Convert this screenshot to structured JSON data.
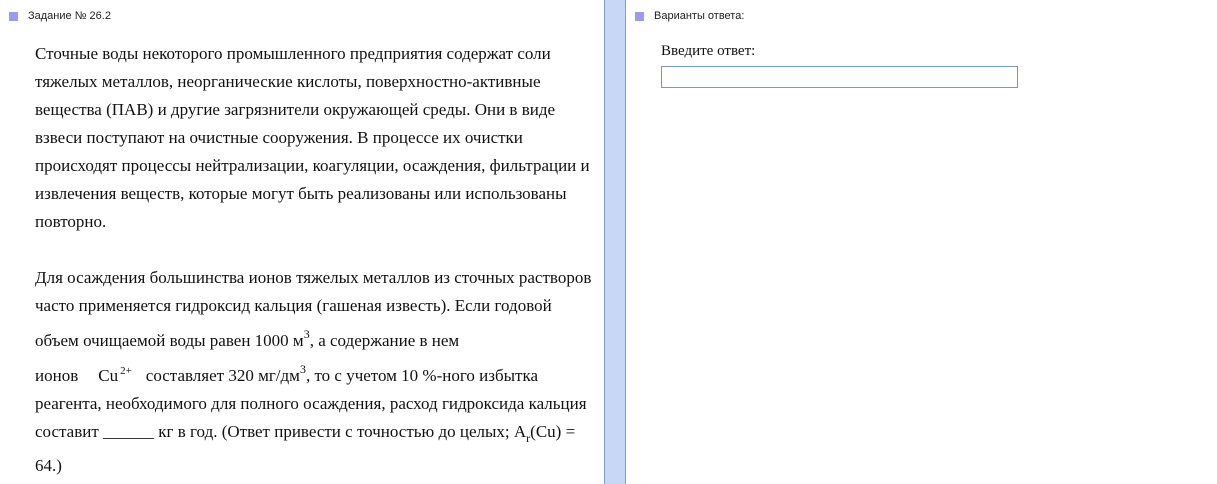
{
  "left_panel": {
    "header": "Задание № 26.2",
    "paragraph1": "Сточные воды некоторого промышленного предприятия содержат соли тяжелых металлов, неорганические кислоты, поверхностно-активные вещества (ПАВ) и другие загрязнители окружающей среды. Они в виде взвеси поступают на очистные сооружения. В процессе их очистки происходят процессы нейтрализации, коагуляции, осаждения, фильтрации и извлечения веществ, которые могут быть реализованы или использованы повторно.",
    "paragraph2": {
      "part1": "Для осаждения большинства ионов тяжелых металлов из сточных растворов часто применяется гидроксид кальция (гашеная известь). Если годовой объем очищаемой воды равен 1000 м",
      "exp1": "3",
      "part2": ", а содержание в нем ионов",
      "ion": "Cu",
      "ion_charge": "2+",
      "part3": "составляет 320 мг/дм",
      "exp2": "3",
      "part4": ", то с учетом 10 %-ного избытка реагента, необходимого для полного осаждения, расход гидроксида кальция составит",
      "blank": "______",
      "part5": " кг в год. (Ответ привести с точностью до целых; A",
      "sub": "r",
      "part6": "(Cu) = 64.)"
    }
  },
  "right_panel": {
    "header": "Варианты ответа:",
    "answer_label": "Введите ответ:",
    "answer_value": ""
  },
  "colors": {
    "bullet": "#9b9bf0",
    "splitter": "#c6d8f5",
    "input_border": "#7a96c2"
  }
}
